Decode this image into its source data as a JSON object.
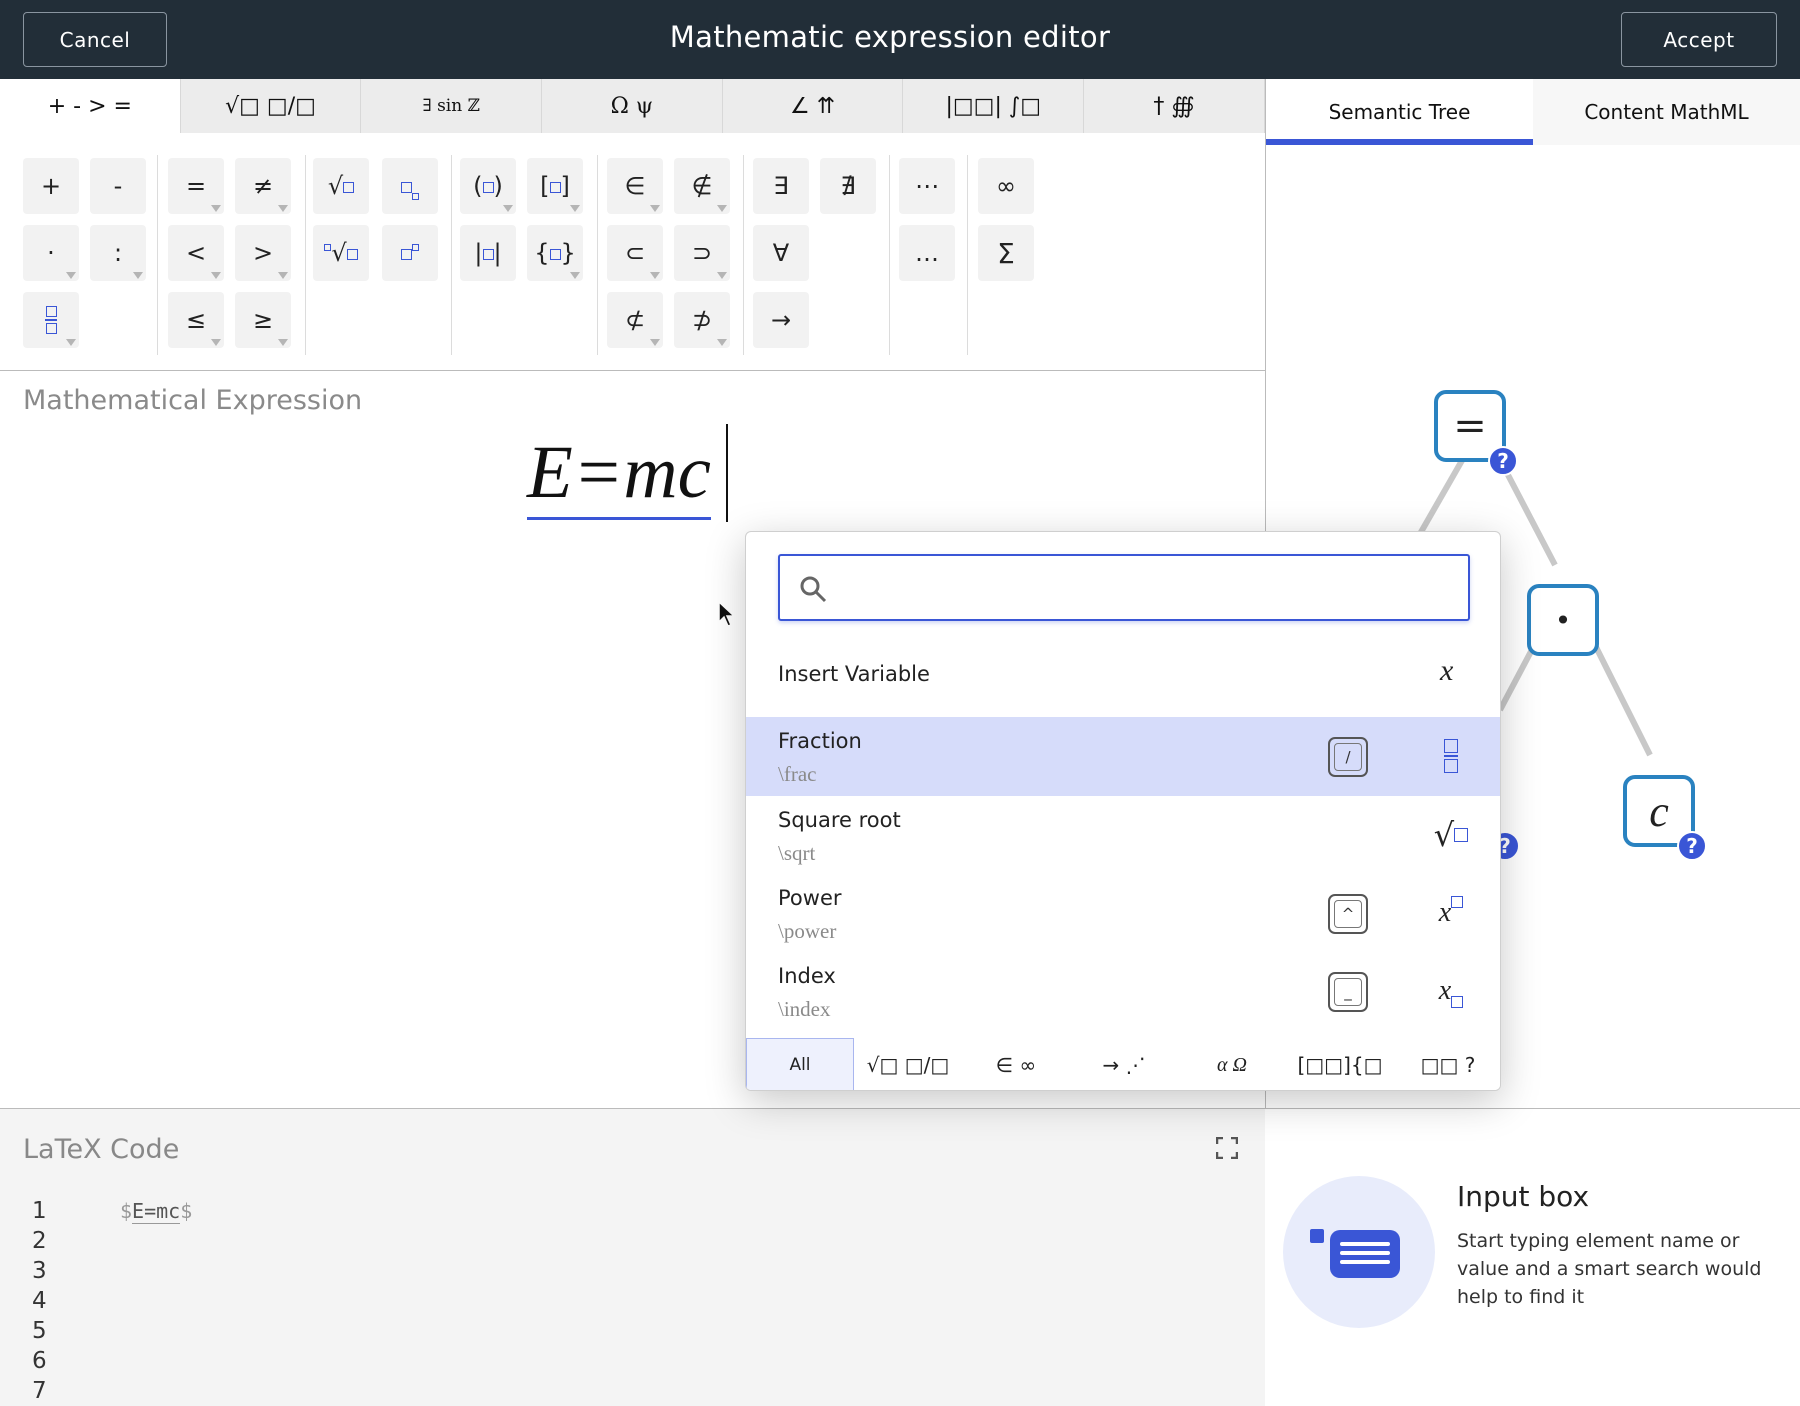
{
  "header": {
    "cancel_label": "Cancel",
    "title": "Mathematic expression editor",
    "accept_label": "Accept"
  },
  "category_tabs": [
    "+ - > =",
    "√□ □/□",
    "∃ sin ℤ",
    "Ω ψ",
    "∠ ⇈",
    "|□□| ∫□",
    "† ∰"
  ],
  "palette": {
    "plus": "+",
    "minus": "-",
    "dot": "·",
    "colon": ":",
    "equals": "=",
    "not_equals": "≠",
    "less": "<",
    "greater": ">",
    "leq": "≤",
    "geq": "≥",
    "element_of": "∈",
    "not_element_of": "∉",
    "subset": "⊂",
    "superset": "⊃",
    "not_subset": "⊄",
    "not_superset": "⊅",
    "exists": "∃",
    "not_exists": "∄",
    "for_all": "∀",
    "right_arrow": "→",
    "center_dots": "⋯",
    "low_dots": "…",
    "infinity": "∞",
    "sum": "Σ",
    "parens": "( )",
    "brackets": "[ ]",
    "abs": "| |",
    "braces": "{ }"
  },
  "expression": {
    "label": "Mathematical Expression",
    "value": "E=mc"
  },
  "right_tabs": {
    "semantic_tree": "Semantic Tree",
    "content_mathml": "Content MathML"
  },
  "tree": {
    "root": "=",
    "dot_node": "•",
    "c_node": "c",
    "badge": "?"
  },
  "latex": {
    "label": "LaTeX Code",
    "line_numbers": [
      "1",
      "2",
      "3",
      "4",
      "5",
      "6",
      "7"
    ],
    "dollar_open": "$",
    "code": "E=mc",
    "dollar_close": "$"
  },
  "hint": {
    "title": "Input box",
    "description": "Start typing element name or value and a smart search would help to find it"
  },
  "popup": {
    "search_value": "",
    "insert_variable": {
      "label": "Insert Variable",
      "preview": "x"
    },
    "items": [
      {
        "name": "Fraction",
        "command": "\\frac",
        "key": "/"
      },
      {
        "name": "Square root",
        "command": "\\sqrt",
        "key": ""
      },
      {
        "name": "Power",
        "command": "\\power",
        "key": "^"
      },
      {
        "name": "Index",
        "command": "\\index",
        "key": "_"
      }
    ],
    "var_x": "x",
    "category_tabs": [
      "All",
      "√□ □/□",
      "∈ ∞",
      "→ ⋰",
      "α Ω",
      "[□□]{□",
      "□□ ?"
    ]
  }
}
